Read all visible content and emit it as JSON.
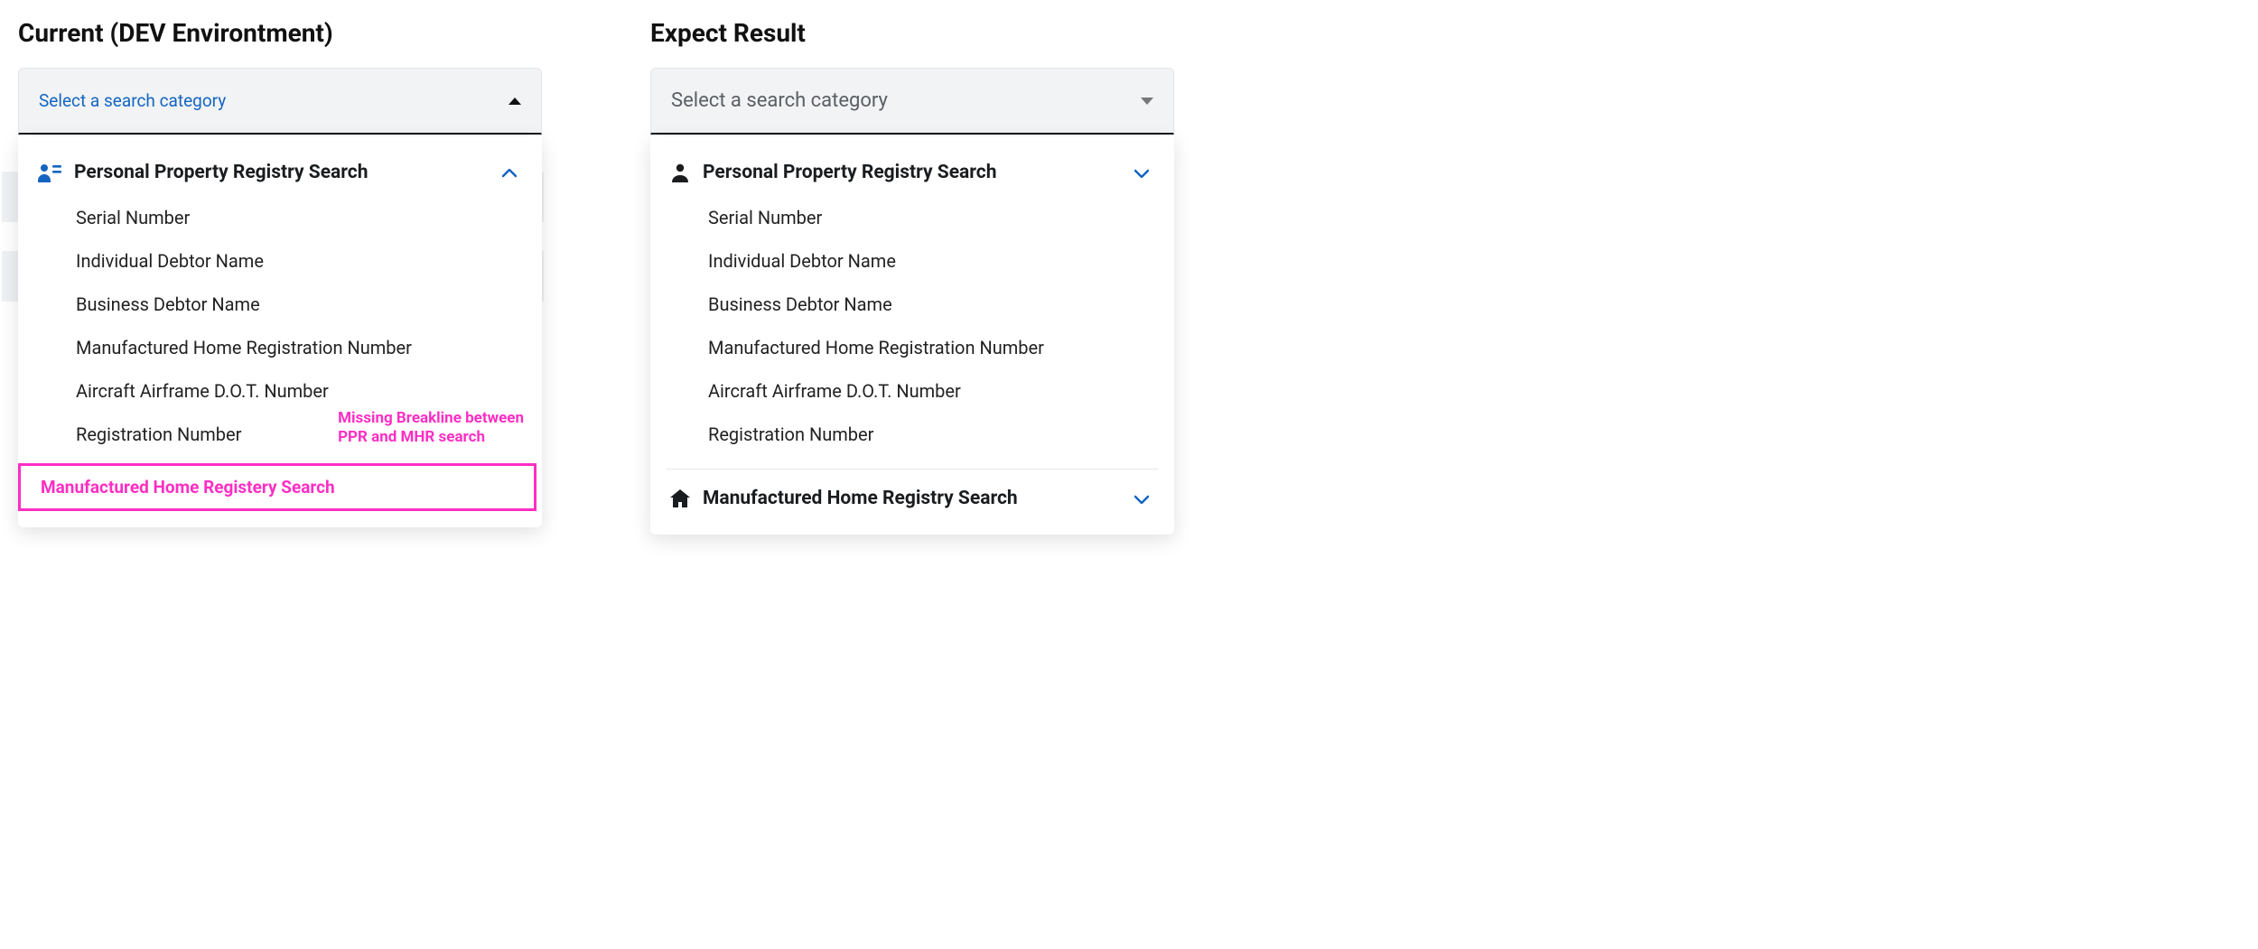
{
  "left": {
    "heading": "Current (DEV Environtment)",
    "select_label": "Select a search category",
    "group1_title": "Personal Property Registry Search",
    "items": [
      "Serial Number",
      "Individual Debtor Name",
      "Business Debtor Name",
      "Manufactured Home Registration Number",
      "Aircraft Airframe D.O.T. Number",
      "Registration Number"
    ],
    "annotation_line1": "Missing Breakline between",
    "annotation_line2": "PPR and MHR search",
    "group2_title": "Manufactured Home Registery Search"
  },
  "right": {
    "heading": "Expect Result",
    "select_label": "Select a search category",
    "group1_title": "Personal Property Registry Search",
    "items": [
      "Serial Number",
      "Individual Debtor Name",
      "Business Debtor Name",
      "Manufactured Home Registration Number",
      "Aircraft Airframe D.O.T. Number",
      "Registration Number"
    ],
    "group2_title": "Manufactured Home Registry Search"
  },
  "colors": {
    "link_blue": "#1565c0",
    "annotation_pink": "#ff2ec4"
  }
}
